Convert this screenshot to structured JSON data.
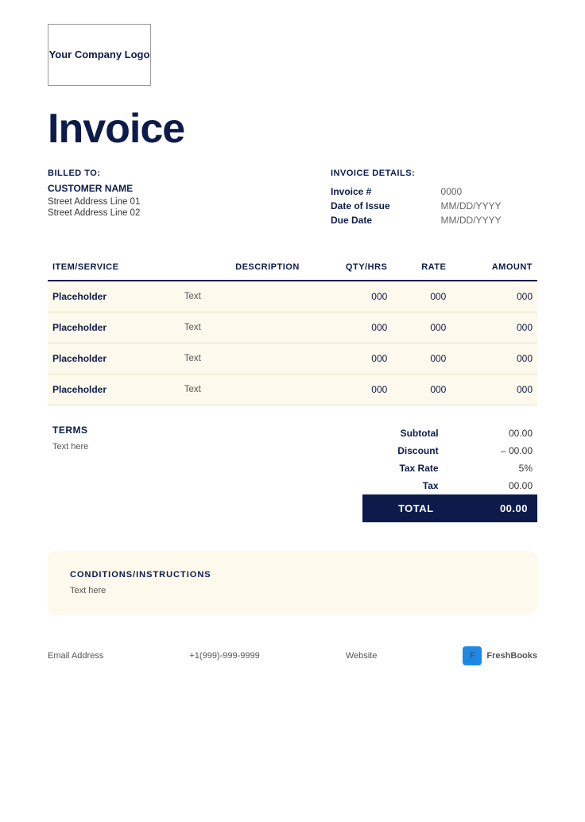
{
  "logo": {
    "text": "Your Company Logo"
  },
  "invoice": {
    "title": "Invoice"
  },
  "billing": {
    "label": "BILLED TO:",
    "customer_name": "CUSTOMER NAME",
    "address_line1": "Street Address Line 01",
    "address_line2": "Street Address Line 02"
  },
  "invoice_details": {
    "label": "INVOICE DETAILS:",
    "fields": [
      {
        "key": "Invoice #",
        "value": "0000"
      },
      {
        "key": "Date of Issue",
        "value": "MM/DD/YYYY"
      },
      {
        "key": "Due Date",
        "value": "MM/DD/YYYY"
      }
    ]
  },
  "table": {
    "headers": [
      "ITEM/SERVICE",
      "DESCRIPTION",
      "QTY/HRS",
      "RATE",
      "AMOUNT"
    ],
    "rows": [
      {
        "item": "Placeholder",
        "description": "Text",
        "qty": "000",
        "rate": "000",
        "amount": "000"
      },
      {
        "item": "Placeholder",
        "description": "Text",
        "qty": "000",
        "rate": "000",
        "amount": "000"
      },
      {
        "item": "Placeholder",
        "description": "Text",
        "qty": "000",
        "rate": "000",
        "amount": "000"
      },
      {
        "item": "Placeholder",
        "description": "Text",
        "qty": "000",
        "rate": "000",
        "amount": "000"
      }
    ]
  },
  "terms": {
    "label": "TERMS",
    "text": "Text here"
  },
  "totals": {
    "subtotal_label": "Subtotal",
    "subtotal_value": "00.00",
    "discount_label": "Discount",
    "discount_value": "– 00.00",
    "tax_rate_label": "Tax Rate",
    "tax_rate_value": "5%",
    "tax_label": "Tax",
    "tax_value": "00.00",
    "total_label": "TOTAL",
    "total_value": "00.00"
  },
  "conditions": {
    "label": "CONDITIONS/INSTRUCTIONS",
    "text": "Text here"
  },
  "footer": {
    "email": "Email Address",
    "phone": "+1(999)-999-9999",
    "website": "Website",
    "brand": "FreshBooks",
    "brand_icon": "F"
  }
}
